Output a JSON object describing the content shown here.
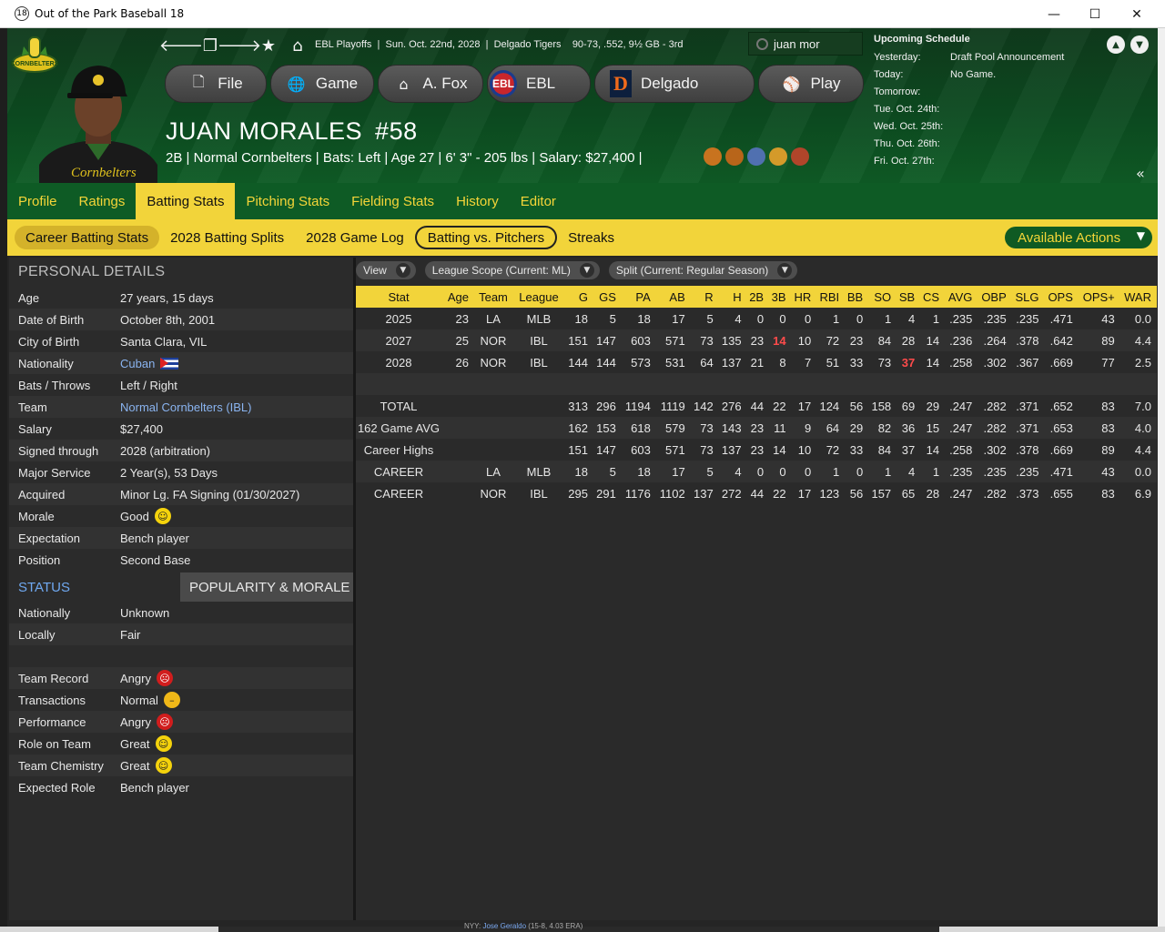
{
  "window": {
    "title": "Out of the Park Baseball 18",
    "icon_text": "18",
    "minimize": "—",
    "maximize": "☐",
    "close": "✕"
  },
  "header": {
    "breadcrumbs": [
      "EBL Playoffs",
      "Sun. Oct. 22nd, 2028",
      "Delgado Tigers",
      "90-73, .552, 9½ GB - 3rd"
    ],
    "search_value": "juan mor",
    "menu": [
      {
        "label": "File",
        "icon": "file-icon"
      },
      {
        "label": "Game",
        "icon": "globe-icon"
      },
      {
        "label": "A. Fox",
        "icon": "home-icon"
      },
      {
        "label": "EBL",
        "icon": "ebl-logo-icon"
      },
      {
        "label": "Delgado",
        "icon": "tigers-logo-icon"
      },
      {
        "label": "Play",
        "icon": "baseball-icon"
      }
    ],
    "player_name": "JUAN MORALES",
    "player_number": "#58",
    "player_info": "2B | Normal Cornbelters  |  Bats: Left  |  Age 27  |  6' 3\" - 205 lbs  |  Salary: $27,400  |",
    "logo_text": "CORNBELTERS"
  },
  "schedule": {
    "title": "Upcoming Schedule",
    "rows": [
      {
        "day": "Yesterday:",
        "event": "Draft Pool Announcement"
      },
      {
        "day": "Today:",
        "event": "No Game."
      },
      {
        "day": "Tomorrow:",
        "event": ""
      },
      {
        "day": "Tue. Oct. 24th:",
        "event": ""
      },
      {
        "day": "Wed. Oct. 25th:",
        "event": ""
      },
      {
        "day": "Thu. Oct. 26th:",
        "event": ""
      },
      {
        "day": "Fri. Oct. 27th:",
        "event": ""
      }
    ]
  },
  "tabs": [
    "Profile",
    "Ratings",
    "Batting Stats",
    "Pitching Stats",
    "Fielding Stats",
    "History",
    "Editor"
  ],
  "subtabs": [
    "Career Batting Stats",
    "2028 Batting Splits",
    "2028 Game Log",
    "Batting vs. Pitchers",
    "Streaks"
  ],
  "available_actions": "Available Actions",
  "personal": {
    "title": "PERSONAL DETAILS",
    "rows": [
      {
        "k": "Age",
        "v": "27 years, 15 days"
      },
      {
        "k": "Date of Birth",
        "v": "October 8th, 2001"
      },
      {
        "k": "City of Birth",
        "v": "Santa Clara, VIL"
      },
      {
        "k": "Nationality",
        "v": "Cuban"
      },
      {
        "k": "Bats / Throws",
        "v": "Left / Right"
      },
      {
        "k": "Team",
        "v": "Normal Cornbelters (IBL)"
      },
      {
        "k": "Salary",
        "v": "$27,400"
      },
      {
        "k": "Signed through",
        "v": "2028 (arbitration)"
      },
      {
        "k": "Major Service",
        "v": "2 Year(s), 53 Days"
      },
      {
        "k": "Acquired",
        "v": "Minor Lg. FA Signing (01/30/2027)"
      },
      {
        "k": "Morale",
        "v": "Good"
      },
      {
        "k": "Expectation",
        "v": "Bench player"
      },
      {
        "k": "Position",
        "v": "Second Base"
      }
    ]
  },
  "status": {
    "tab1": "STATUS",
    "tab2": "POPULARITY & MORALE",
    "rows": [
      {
        "k": "Nationally",
        "v": "Unknown"
      },
      {
        "k": "Locally",
        "v": "Fair"
      },
      {
        "k": "",
        "v": ""
      },
      {
        "k": "Team Record",
        "v": "Angry"
      },
      {
        "k": "Transactions",
        "v": "Normal"
      },
      {
        "k": "Performance",
        "v": "Angry"
      },
      {
        "k": "Role on Team",
        "v": "Great"
      },
      {
        "k": "Team Chemistry",
        "v": "Great"
      },
      {
        "k": "Expected Role",
        "v": "Bench player"
      }
    ]
  },
  "filters": [
    {
      "label": "View"
    },
    {
      "label": "League Scope  (Current: ML)"
    },
    {
      "label": "Split  (Current: Regular Season)"
    }
  ],
  "stats": {
    "headers": [
      "Stat",
      "Age",
      "Team",
      "League",
      "G",
      "GS",
      "PA",
      "AB",
      "R",
      "H",
      "2B",
      "3B",
      "HR",
      "RBI",
      "BB",
      "SO",
      "SB",
      "CS",
      "AVG",
      "OBP",
      "SLG",
      "OPS",
      "OPS+",
      "WAR"
    ],
    "rows": [
      [
        "2025",
        "23",
        "LA",
        "MLB",
        "18",
        "5",
        "18",
        "17",
        "5",
        "4",
        "0",
        "0",
        "0",
        "1",
        "0",
        "1",
        "4",
        "1",
        ".235",
        ".235",
        ".235",
        ".471",
        "43",
        "0.0"
      ],
      [
        "2027",
        "25",
        "NOR",
        "IBL",
        "151",
        "147",
        "603",
        "571",
        "73",
        "135",
        "23",
        "14",
        "10",
        "72",
        "23",
        "84",
        "28",
        "14",
        ".236",
        ".264",
        ".378",
        ".642",
        "89",
        "4.4"
      ],
      [
        "2028",
        "26",
        "NOR",
        "IBL",
        "144",
        "144",
        "573",
        "531",
        "64",
        "137",
        "21",
        "8",
        "7",
        "51",
        "33",
        "73",
        "37",
        "14",
        ".258",
        ".302",
        ".367",
        ".669",
        "77",
        "2.5"
      ],
      [
        "",
        "",
        "",
        "",
        "",
        "",
        "",
        "",
        "",
        "",
        "",
        "",
        "",
        "",
        "",
        "",
        "",
        "",
        "",
        "",
        "",
        "",
        "",
        ""
      ],
      [
        "TOTAL",
        "",
        "",
        "",
        "313",
        "296",
        "1194",
        "1119",
        "142",
        "276",
        "44",
        "22",
        "17",
        "124",
        "56",
        "158",
        "69",
        "29",
        ".247",
        ".282",
        ".371",
        ".652",
        "83",
        "7.0"
      ],
      [
        "162 Game AVG",
        "",
        "",
        "",
        "162",
        "153",
        "618",
        "579",
        "73",
        "143",
        "23",
        "11",
        "9",
        "64",
        "29",
        "82",
        "36",
        "15",
        ".247",
        ".282",
        ".371",
        ".653",
        "83",
        "4.0"
      ],
      [
        "Career Highs",
        "",
        "",
        "",
        "151",
        "147",
        "603",
        "571",
        "73",
        "137",
        "23",
        "14",
        "10",
        "72",
        "33",
        "84",
        "37",
        "14",
        ".258",
        ".302",
        ".378",
        ".669",
        "89",
        "4.4"
      ],
      [
        "CAREER",
        "",
        "LA",
        "MLB",
        "18",
        "5",
        "18",
        "17",
        "5",
        "4",
        "0",
        "0",
        "0",
        "1",
        "0",
        "1",
        "4",
        "1",
        ".235",
        ".235",
        ".235",
        ".471",
        "43",
        "0.0"
      ],
      [
        "CAREER",
        "",
        "NOR",
        "IBL",
        "295",
        "291",
        "1176",
        "1102",
        "137",
        "272",
        "44",
        "22",
        "17",
        "123",
        "56",
        "157",
        "65",
        "28",
        ".247",
        ".282",
        ".373",
        ".655",
        "83",
        "6.9"
      ]
    ],
    "highlights": [
      [
        1,
        11
      ],
      [
        2,
        16
      ]
    ]
  },
  "bottom_ticker": {
    "prefix": "NYY:",
    "link": "Jose Geraldo",
    "suffix": "(15-8, 4.03 ERA)"
  }
}
